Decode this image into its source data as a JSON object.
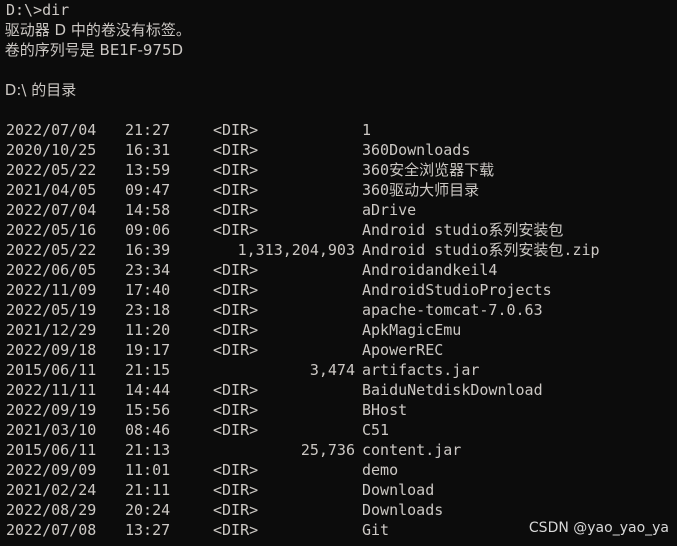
{
  "terminal": {
    "prompt_line": "D:\\>dir",
    "volume_label_line": " 驱动器 D 中的卷没有标签。",
    "volume_serial_line": " 卷的序列号是 BE1F-975D",
    "directory_of_line": " D:\\ 的目录",
    "dir_marker": "<DIR>",
    "background_color": "#0c0c0c",
    "text_color": "#ccc8c4"
  },
  "listing": {
    "columns": [
      "date",
      "time",
      "size",
      "name"
    ],
    "entries": [
      {
        "date": "2022/07/04",
        "time": "21:27",
        "size": "",
        "is_dir": true,
        "name": "1"
      },
      {
        "date": "2020/10/25",
        "time": "16:31",
        "size": "",
        "is_dir": true,
        "name": "360Downloads"
      },
      {
        "date": "2022/05/22",
        "time": "13:59",
        "size": "",
        "is_dir": true,
        "name": "360安全浏览器下载"
      },
      {
        "date": "2021/04/05",
        "time": "09:47",
        "size": "",
        "is_dir": true,
        "name": "360驱动大师目录"
      },
      {
        "date": "2022/07/04",
        "time": "14:58",
        "size": "",
        "is_dir": true,
        "name": "aDrive"
      },
      {
        "date": "2022/05/16",
        "time": "09:06",
        "size": "",
        "is_dir": true,
        "name": "Android studio系列安装包"
      },
      {
        "date": "2022/05/22",
        "time": "16:39",
        "size": "1,313,204,903",
        "is_dir": false,
        "name": "Android studio系列安装包.zip"
      },
      {
        "date": "2022/06/05",
        "time": "23:34",
        "size": "",
        "is_dir": true,
        "name": "Androidandkeil4"
      },
      {
        "date": "2022/11/09",
        "time": "17:40",
        "size": "",
        "is_dir": true,
        "name": "AndroidStudioProjects"
      },
      {
        "date": "2022/05/19",
        "time": "23:18",
        "size": "",
        "is_dir": true,
        "name": "apache-tomcat-7.0.63"
      },
      {
        "date": "2021/12/29",
        "time": "11:20",
        "size": "",
        "is_dir": true,
        "name": "ApkMagicEmu"
      },
      {
        "date": "2022/09/18",
        "time": "19:17",
        "size": "",
        "is_dir": true,
        "name": "ApowerREC"
      },
      {
        "date": "2015/06/11",
        "time": "21:15",
        "size": "3,474",
        "is_dir": false,
        "name": "artifacts.jar"
      },
      {
        "date": "2022/11/11",
        "time": "14:44",
        "size": "",
        "is_dir": true,
        "name": "BaiduNetdiskDownload"
      },
      {
        "date": "2022/09/19",
        "time": "15:56",
        "size": "",
        "is_dir": true,
        "name": "BHost"
      },
      {
        "date": "2021/03/10",
        "time": "08:46",
        "size": "",
        "is_dir": true,
        "name": "C51"
      },
      {
        "date": "2015/06/11",
        "time": "21:13",
        "size": "25,736",
        "is_dir": false,
        "name": "content.jar"
      },
      {
        "date": "2022/09/09",
        "time": "11:01",
        "size": "",
        "is_dir": true,
        "name": "demo"
      },
      {
        "date": "2021/02/24",
        "time": "21:11",
        "size": "",
        "is_dir": true,
        "name": "Download"
      },
      {
        "date": "2022/08/29",
        "time": "20:24",
        "size": "",
        "is_dir": true,
        "name": "Downloads"
      },
      {
        "date": "2022/07/08",
        "time": "13:27",
        "size": "",
        "is_dir": true,
        "name": "Git"
      }
    ]
  },
  "watermark": {
    "text": "CSDN @yao_yao_ya"
  }
}
